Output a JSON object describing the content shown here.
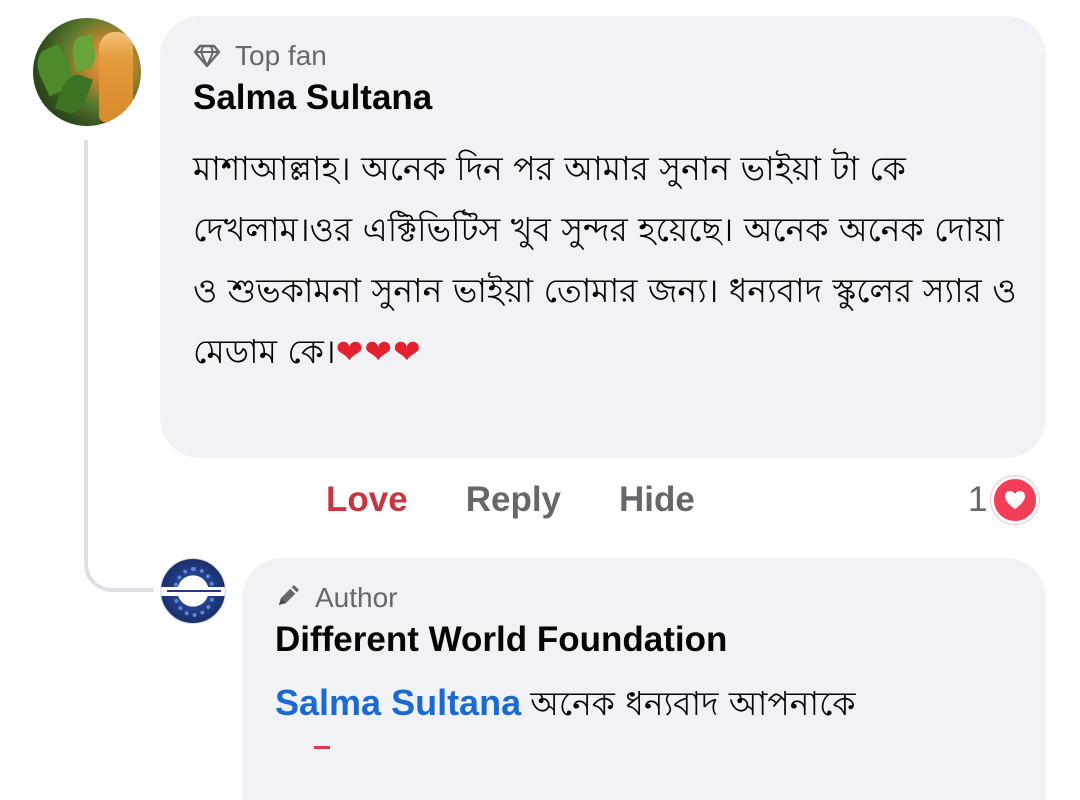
{
  "comment": {
    "badge_label": "Top fan",
    "badge_icon": "diamond-icon",
    "author_name": "Salma Sultana",
    "text": "মাশাআল্লাহ। অনেক দিন পর আমার সুনান ভাইয়া টা কে দেখলাম।ওর এক্টিভিটিস খুব সুন্দর হয়েছে। অনেক অনেক দোয়া ও শুভকামনা সুনান ভাইয়া তোমার জন্য। ধন্যবাদ স্কুলের স্যার ও মেডাম কে।",
    "hearts": "❤❤❤",
    "actions": {
      "love_label": "Love",
      "reply_label": "Reply",
      "hide_label": "Hide"
    },
    "reaction_count": "1",
    "reaction_type": "love-reaction-icon"
  },
  "reply": {
    "badge_label": "Author",
    "badge_icon": "pencil-icon",
    "author_name": "Different World Foundation",
    "mention": "Salma Sultana",
    "text": "অনেক ধন্যবাদ আপনাকে"
  },
  "colors": {
    "bubble_bg": "#f0f2f5",
    "love_active": "#c8363e",
    "mention_blue": "#1b6ad3",
    "reaction_red": "#f33e58",
    "muted_text": "#65676b"
  }
}
